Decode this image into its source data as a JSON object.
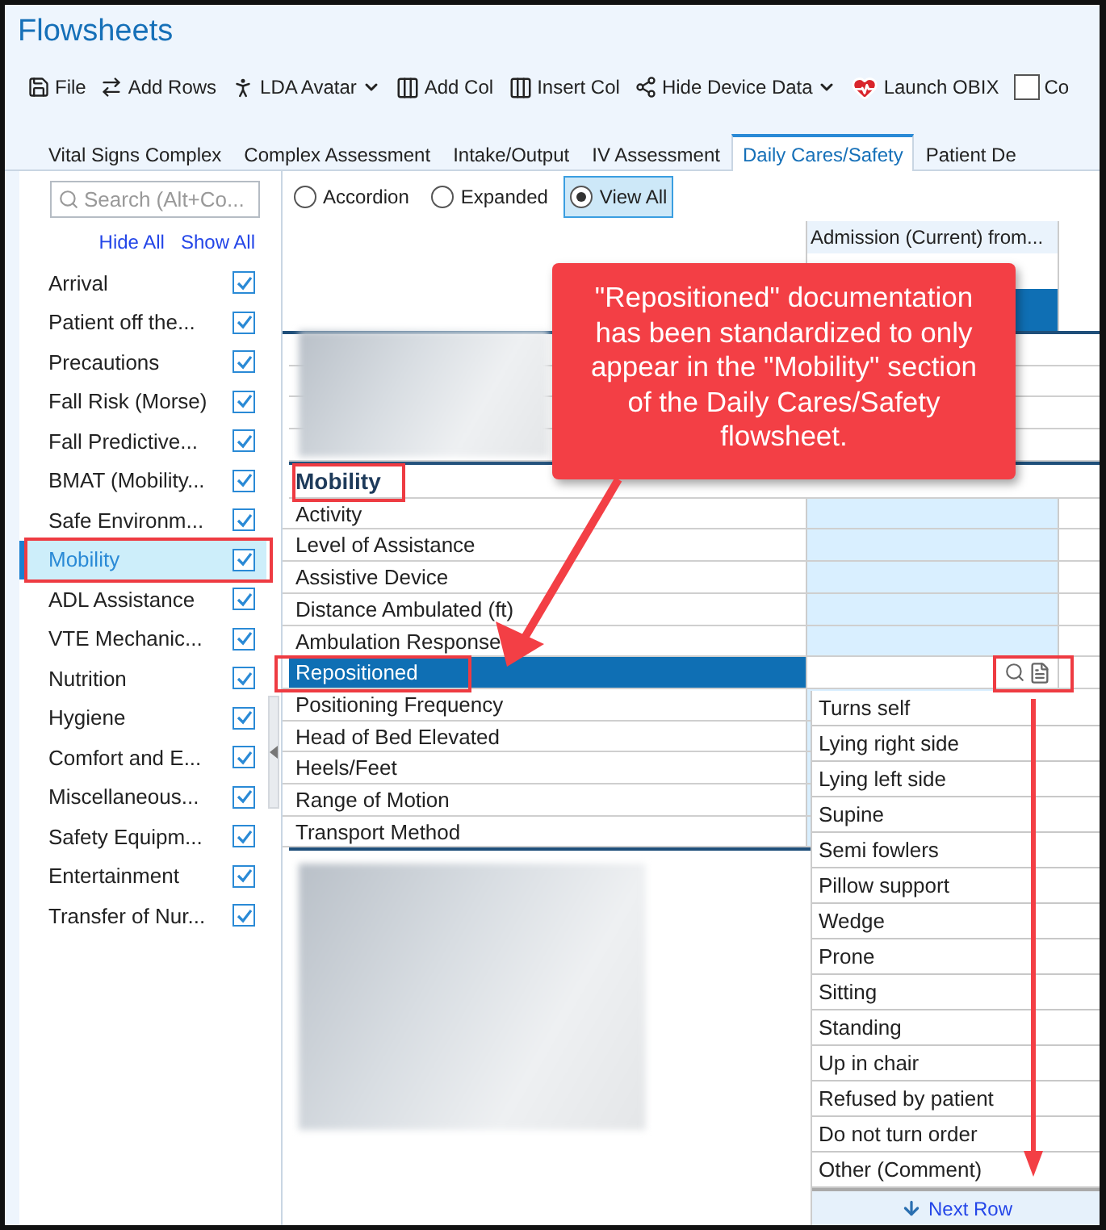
{
  "window": {
    "title": "Flowsheets"
  },
  "toolbar": [
    {
      "label": "File",
      "kind": "save",
      "has_menu": false
    },
    {
      "label": "Add Rows",
      "kind": "add-rows",
      "has_menu": false
    },
    {
      "label": "LDA Avatar",
      "kind": "person",
      "has_menu": true
    },
    {
      "label": "Add Col",
      "kind": "add-col",
      "has_menu": false
    },
    {
      "label": "Insert Col",
      "kind": "insert-col",
      "has_menu": false
    },
    {
      "label": "Hide Device Data",
      "kind": "device",
      "has_menu": true
    },
    {
      "label": "Launch OBIX",
      "kind": "heart",
      "has_menu": false
    },
    {
      "label": "Co",
      "kind": "checkbox",
      "checked": false
    }
  ],
  "tabs": [
    {
      "label": "Vital Signs Complex",
      "selected": false
    },
    {
      "label": "Complex Assessment",
      "selected": false
    },
    {
      "label": "Intake/Output",
      "selected": false
    },
    {
      "label": "IV Assessment",
      "selected": false
    },
    {
      "label": "Daily Cares/Safety",
      "selected": true
    },
    {
      "label": "Patient De",
      "selected": false
    }
  ],
  "sidebar": {
    "search": {
      "placeholder": "Search (Alt+Co..."
    },
    "links": [
      "Hide All",
      "Show All"
    ],
    "items": [
      {
        "label": "Arrival",
        "checked": true,
        "selected": false
      },
      {
        "label": "Patient off the...",
        "checked": true,
        "selected": false
      },
      {
        "label": "Precautions",
        "checked": true,
        "selected": false
      },
      {
        "label": "Fall Risk (Morse)",
        "checked": true,
        "selected": false
      },
      {
        "label": "Fall Predictive...",
        "checked": true,
        "selected": false
      },
      {
        "label": "BMAT (Mobility...",
        "checked": true,
        "selected": false
      },
      {
        "label": "Safe Environm...",
        "checked": true,
        "selected": false
      },
      {
        "label": "Mobility",
        "checked": true,
        "selected": true
      },
      {
        "label": "ADL Assistance",
        "checked": true,
        "selected": false
      },
      {
        "label": "VTE Mechanic...",
        "checked": true,
        "selected": false
      },
      {
        "label": "Nutrition",
        "checked": true,
        "selected": false
      },
      {
        "label": "Hygiene",
        "checked": true,
        "selected": false
      },
      {
        "label": "Comfort and E...",
        "checked": true,
        "selected": false
      },
      {
        "label": "Miscellaneous...",
        "checked": true,
        "selected": false
      },
      {
        "label": "Safety Equipm...",
        "checked": true,
        "selected": false
      },
      {
        "label": "Entertainment",
        "checked": true,
        "selected": false
      },
      {
        "label": "Transfer of Nur...",
        "checked": true,
        "selected": false
      }
    ]
  },
  "view_modes": [
    {
      "label": "Accordion",
      "selected": false
    },
    {
      "label": "Expanded",
      "selected": false
    },
    {
      "label": "View All",
      "selected": true
    }
  ],
  "grid": {
    "column_header": "Admission (Current) from...",
    "section": {
      "title": "Mobility",
      "rows": [
        {
          "label": "Activity",
          "selected": false
        },
        {
          "label": "Level of Assistance",
          "selected": false
        },
        {
          "label": "Assistive Device",
          "selected": false
        },
        {
          "label": "Distance Ambulated (ft)",
          "selected": false
        },
        {
          "label": "Ambulation Response",
          "selected": false
        },
        {
          "label": "Repositioned",
          "selected": true
        },
        {
          "label": "Positioning Frequency",
          "selected": false
        },
        {
          "label": "Head of Bed Elevated",
          "selected": false
        },
        {
          "label": "Heels/Feet",
          "selected": false
        },
        {
          "label": "Range of Motion",
          "selected": false
        },
        {
          "label": "Transport Method",
          "selected": false
        }
      ]
    }
  },
  "dropdown": {
    "options": [
      "Turns self",
      "Lying right side",
      "Lying left side",
      "Supine",
      "Semi fowlers",
      "Pillow support",
      "Wedge",
      "Prone",
      "Sitting",
      "Standing",
      "Up in chair",
      "Refused by patient",
      "Do not turn order",
      "Other (Comment)"
    ],
    "footer": "Next Row"
  },
  "callout": {
    "text": "\"Repositioned\" documentation has been standardized to only appear in the \"Mobility\" section of the Daily Cares/Safety flowsheet."
  }
}
